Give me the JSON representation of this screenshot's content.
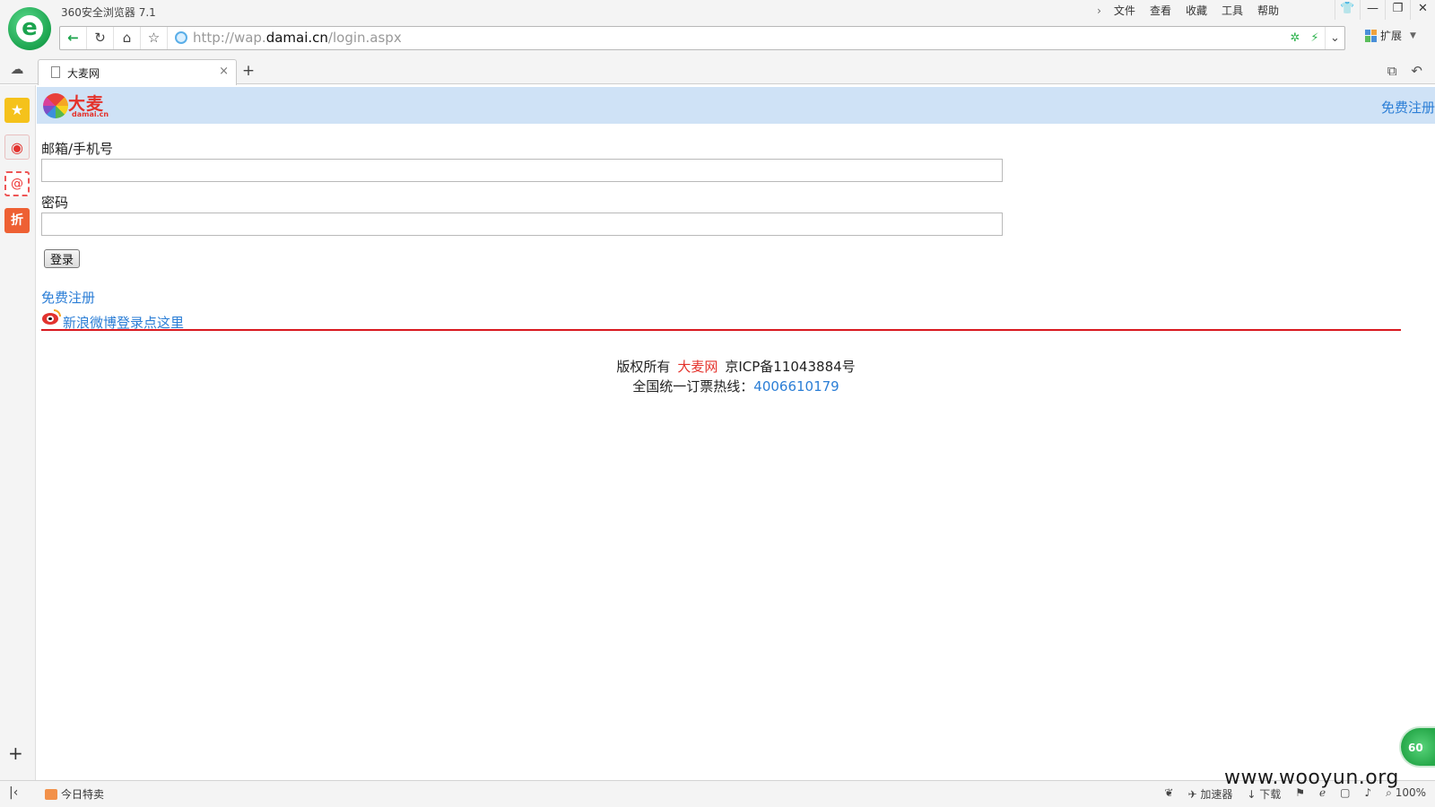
{
  "browser": {
    "title": "360安全浏览器 7.1",
    "menu": [
      "文件",
      "查看",
      "收藏",
      "工具",
      "帮助"
    ],
    "window_controls": [
      "shirt-icon",
      "minimize-icon",
      "restore-icon",
      "close-icon"
    ],
    "url_scheme_prefix": "http://wap.",
    "url_host": "damai.cn",
    "url_path": "/login.aspx",
    "extensions_label": "扩展",
    "tab_title": "大麦网",
    "tab_close": "×",
    "new_tab": "+",
    "sidebar_add": "+",
    "status_today": "今日特卖",
    "status_accelerator": "加速器",
    "status_download": "下载",
    "zoom": "100%",
    "floater_text": "60"
  },
  "site": {
    "logo_text": "大麦",
    "logo_sub": "damai.cn",
    "header_register": "免费注册",
    "email_label": "邮箱/手机号",
    "email_value": "",
    "password_label": "密码",
    "password_value": "",
    "login_button": "登录",
    "register_link": "免费注册",
    "weibo_link": "新浪微博登录点这里",
    "footer_copyright": "版权所有",
    "footer_brand": "大麦网",
    "footer_icp": "京ICP备11043884号",
    "footer_hotline_label": "全国统一订票热线：",
    "footer_hotline": "4006610179"
  },
  "colors": {
    "header_bg": "#cfe2f6",
    "link": "#2b7ed6",
    "brand_red": "#e4322b",
    "divider": "#d9191f"
  },
  "watermark": "www.wooyun.org"
}
